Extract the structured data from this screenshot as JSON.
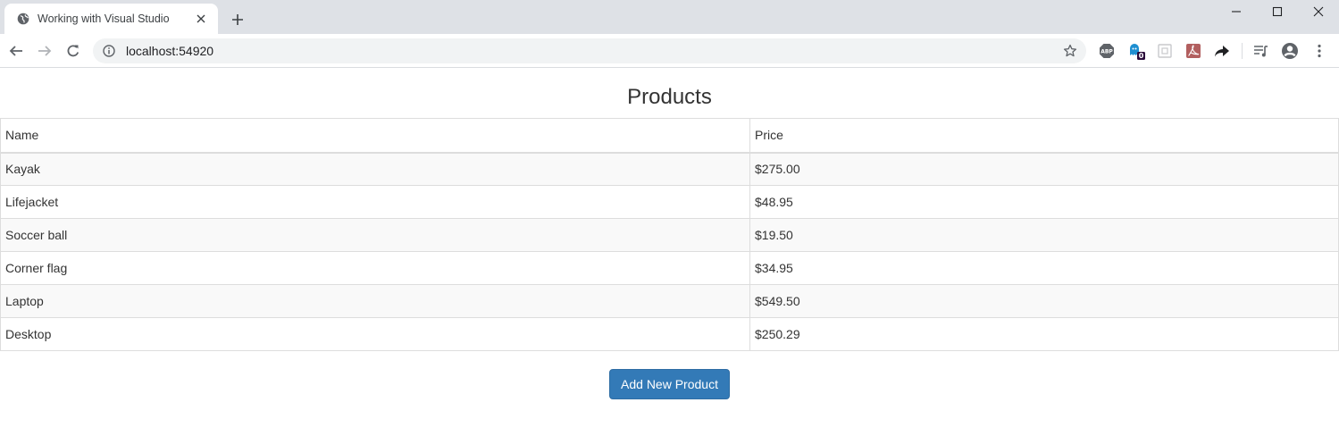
{
  "browser": {
    "tab_title": "Working with Visual Studio",
    "url": "localhost:54920",
    "extensions": [
      "abp-icon",
      "ghostery-icon",
      "extension-icon",
      "pdf-icon",
      "share-arrow-icon",
      "media-queue-icon",
      "account-icon",
      "menu-dots-icon"
    ],
    "ghostery_badge": "0"
  },
  "page": {
    "heading": "Products",
    "columns": [
      "Name",
      "Price"
    ],
    "rows": [
      [
        "Kayak",
        "$275.00"
      ],
      [
        "Lifejacket",
        "$48.95"
      ],
      [
        "Soccer ball",
        "$19.50"
      ],
      [
        "Corner flag",
        "$34.95"
      ],
      [
        "Laptop",
        "$549.50"
      ],
      [
        "Desktop",
        "$250.29"
      ]
    ],
    "add_button_label": "Add New Product"
  },
  "colors": {
    "primary_button": "#337ab7",
    "table_stripe": "#f9f9f9",
    "tabstrip_bg": "#dee1e6"
  }
}
